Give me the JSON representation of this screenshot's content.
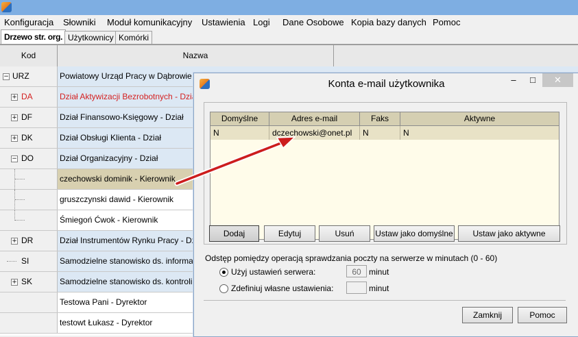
{
  "menu": [
    "Konfiguracja",
    "Słowniki",
    "Moduł komunikacyjny",
    "Ustawienia",
    "Logi",
    "Dane Osobowe",
    "Kopia bazy danych",
    "Pomoc"
  ],
  "tabs": [
    "Drzewo str. org.",
    "Użytkownicy",
    "Komórki"
  ],
  "grid": {
    "col_kod": "Kod",
    "col_nazwa": "Nazwa",
    "rows": [
      {
        "kod": "URZ",
        "nazwa": "Powiatowy Urząd Pracy w Dąbrowie Gó"
      },
      {
        "kod": "DA",
        "nazwa": "Dział Aktywizacji Bezrobotnych - Dział"
      },
      {
        "kod": "DF",
        "nazwa": "Dział Finansowo-Księgowy - Dział"
      },
      {
        "kod": "DK",
        "nazwa": "Dział Obsługi Klienta - Dział"
      },
      {
        "kod": "DO",
        "nazwa": "Dział Organizacyjny - Dział"
      },
      {
        "kod": "",
        "nazwa": "czechowski dominik - Kierownik"
      },
      {
        "kod": "",
        "nazwa": "gruszczynski dawid - Kierownik"
      },
      {
        "kod": "",
        "nazwa": "Śmiegoń Ćwok - Kierownik"
      },
      {
        "kod": "DR",
        "nazwa": "Dział Instrumentów Rynku Pracy - Dział"
      },
      {
        "kod": "SI",
        "nazwa": "Samodzielne stanowisko ds. informatyki"
      },
      {
        "kod": "SK",
        "nazwa": "Samodzielne stanowisko ds. kontroli - S"
      },
      {
        "kod": "",
        "nazwa": "Testowa Pani - Dyrektor"
      },
      {
        "kod": "",
        "nazwa": "testowt Łukasz - Dyrektor"
      }
    ]
  },
  "dialog": {
    "title": "Konta e-mail użytkownika",
    "table": {
      "headers": [
        "Domyślne",
        "Adres e-mail",
        "Faks",
        "Aktywne"
      ],
      "rows": [
        {
          "domyslne": "N",
          "email": "dczechowski@onet.pl",
          "faks": "N",
          "aktywne": "N"
        }
      ]
    },
    "buttons": {
      "dodaj": "Dodaj",
      "edytuj": "Edytuj",
      "usun": "Usuń",
      "domyslne": "Ustaw jako domyślne",
      "aktywne": "Ustaw jako aktywne",
      "zamknij": "Zamknij",
      "pomoc": "Pomoc"
    },
    "interval_label": "Odstęp pomiędzy operacją sprawdzania poczty na serwerze w minutach (0 - 60)",
    "option_server": "Użyj ustawień serwera:",
    "option_custom": "Zdefiniuj własne ustawienia:",
    "server_value": "60",
    "custom_value": "",
    "unit": "minut"
  },
  "colors": {
    "accent_red": "#d42020",
    "selected_row": "#d8d0b0",
    "titlebar": "#7eaee2"
  }
}
